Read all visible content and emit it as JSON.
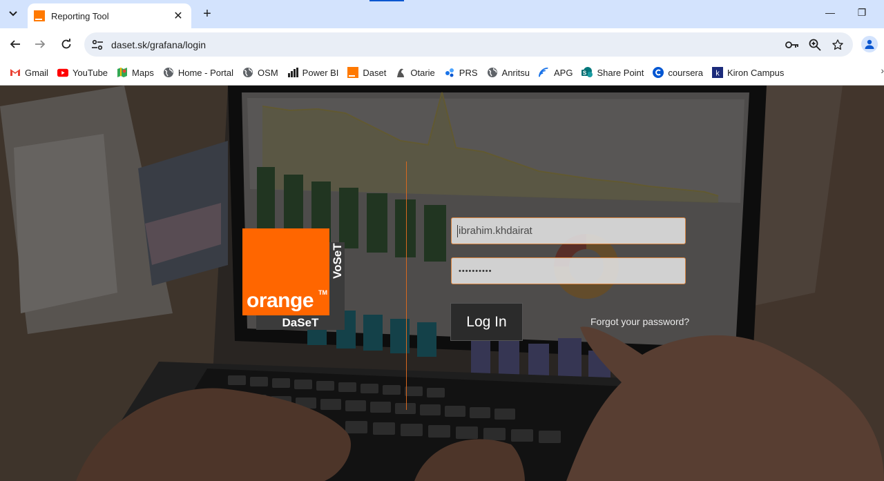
{
  "browser": {
    "tab": {
      "title": "Reporting Tool",
      "close": "✕"
    },
    "new_tab": "+",
    "window_controls": {
      "minimize": "—",
      "restore": "❐"
    },
    "url": "daset.sk/grafana/login",
    "bookmarks": [
      {
        "label": "Gmail",
        "icon": "gmail-icon"
      },
      {
        "label": "YouTube",
        "icon": "youtube-icon"
      },
      {
        "label": "Maps",
        "icon": "maps-icon"
      },
      {
        "label": "Home - Portal",
        "icon": "globe-icon"
      },
      {
        "label": "OSM",
        "icon": "globe-icon"
      },
      {
        "label": "Power BI",
        "icon": "powerbi-icon"
      },
      {
        "label": "Daset",
        "icon": "orange-icon"
      },
      {
        "label": "Otarie",
        "icon": "otarie-icon"
      },
      {
        "label": "PRS",
        "icon": "prs-icon"
      },
      {
        "label": "Anritsu",
        "icon": "globe-icon"
      },
      {
        "label": "APG",
        "icon": "apg-icon"
      },
      {
        "label": "Share Point",
        "icon": "sharepoint-icon"
      },
      {
        "label": "coursera",
        "icon": "coursera-icon"
      },
      {
        "label": "Kiron Campus",
        "icon": "kiron-icon"
      }
    ]
  },
  "login": {
    "logo": {
      "word": "orange",
      "tm": "TM",
      "vertical": "VoSeT",
      "bottom": "DaSeT"
    },
    "username": "ibrahim.khdairat",
    "password_mask": "••••••••••",
    "login_button": "Log In",
    "forgot": "Forgot your password?"
  },
  "colors": {
    "accent": "#ff6600",
    "chrome_tab_bg": "#d3e3fd",
    "omnibox": "#e9eef6"
  }
}
